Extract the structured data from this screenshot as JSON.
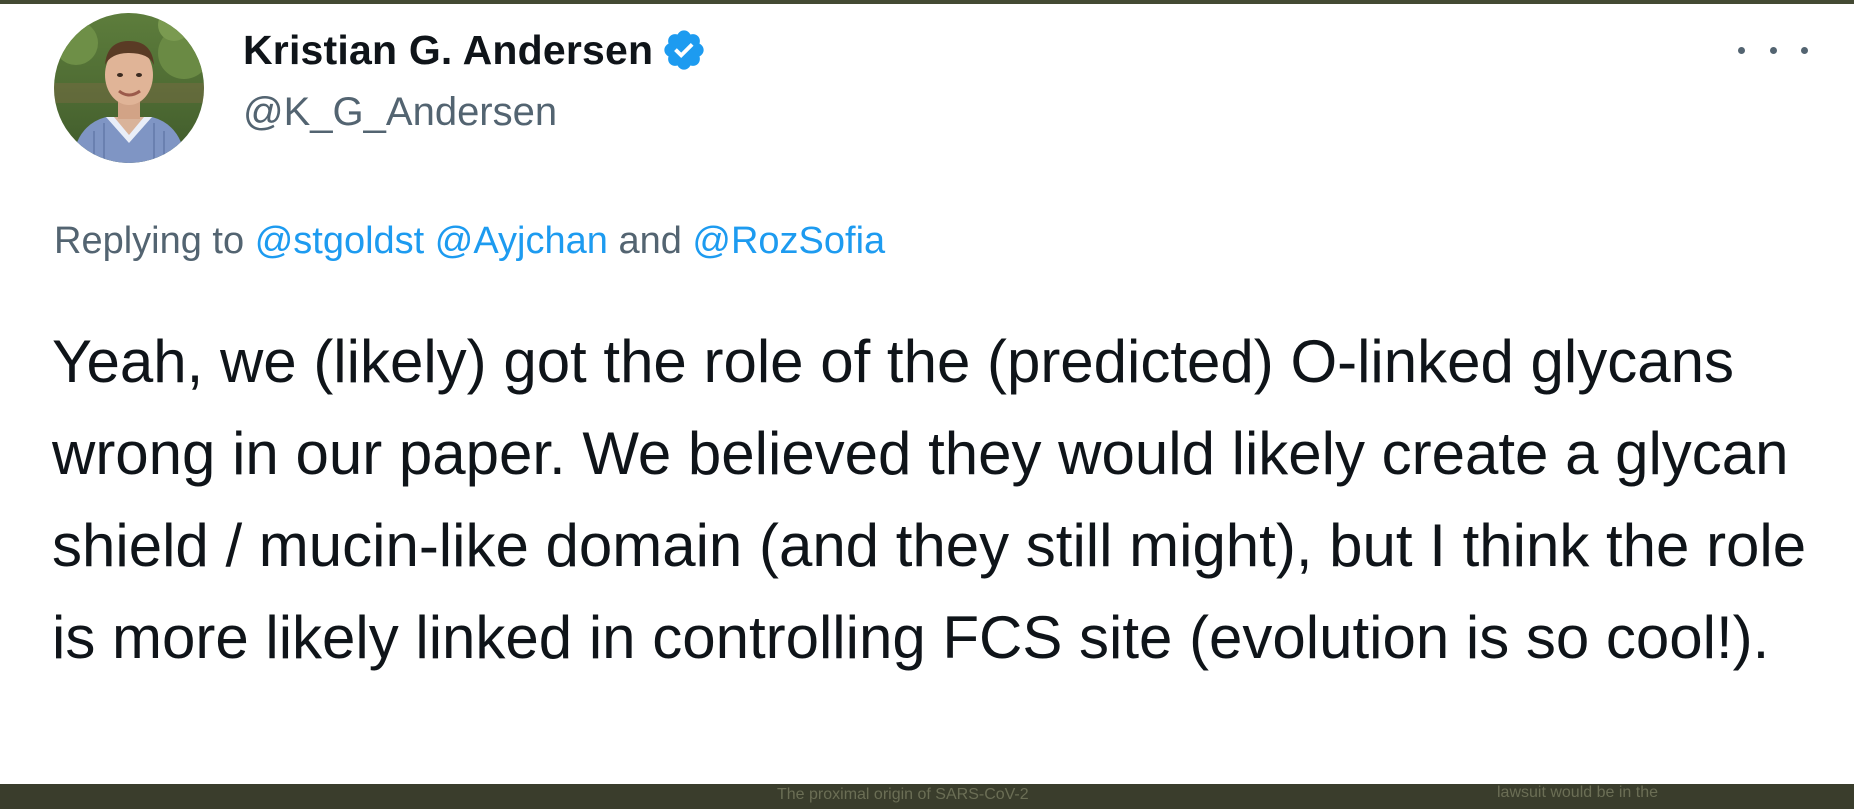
{
  "tweet": {
    "author": {
      "display_name": "Kristian G. Andersen",
      "handle": "@K_G_Andersen",
      "verified": true,
      "avatar_icon": "profile-photo"
    },
    "more_icon": "more-horizontal-icon",
    "reply_context": {
      "prefix": "Replying to",
      "mentions": [
        "@stgoldst",
        "@Ayjchan",
        "@RozSofia"
      ],
      "conjunction": "and"
    },
    "text": "Yeah, we (likely) got the role of the (predicted) O-linked glycans wrong in our paper. We believed they would likely create a glycan shield / mucin-like domain (and they still might), but I think the role is more likely linked in controlling FCS site (evolution is so cool!)."
  },
  "background_bleed": {
    "left_text": "The proximal origin of SARS-CoV-2",
    "right_text": "lawsuit would be in the"
  },
  "colors": {
    "link": "#1d9bf0",
    "verified_badge": "#1d9bf0",
    "secondary_text": "#536471",
    "primary_text": "#0f1419",
    "surround": "#3a3d2c"
  }
}
